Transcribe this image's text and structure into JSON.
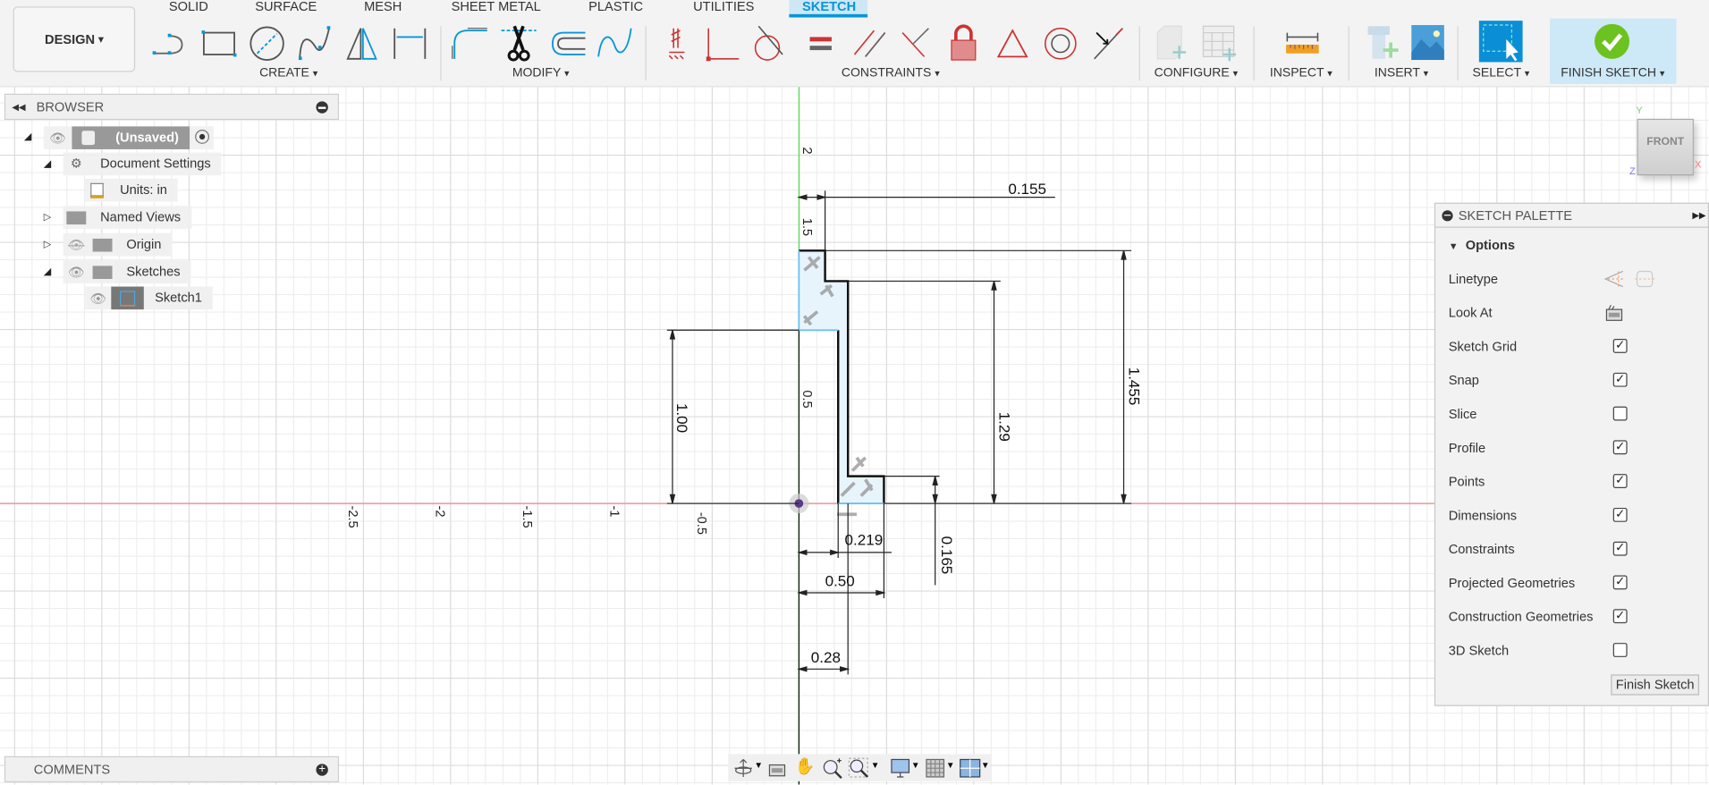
{
  "toolbar": {
    "workspace": "DESIGN",
    "tabs": [
      {
        "label": "SOLID"
      },
      {
        "label": "SURFACE"
      },
      {
        "label": "MESH"
      },
      {
        "label": "SHEET METAL"
      },
      {
        "label": "PLASTIC"
      },
      {
        "label": "UTILITIES"
      },
      {
        "label": "SKETCH",
        "active": true
      }
    ],
    "groups": {
      "create": "CREATE",
      "modify": "MODIFY",
      "constraints": "CONSTRAINTS",
      "configure": "CONFIGURE",
      "inspect": "INSPECT",
      "insert": "INSERT",
      "select": "SELECT",
      "finish": "FINISH SKETCH"
    },
    "dropdown_glyph": "▾",
    "accent": "#0696d7"
  },
  "browser": {
    "title": "BROWSER",
    "items": [
      {
        "label": "(Unsaved)",
        "icon": "component-icon"
      },
      {
        "label": "Document Settings",
        "icon": "gear-icon"
      },
      {
        "label": "Units: in",
        "icon": "units-icon"
      },
      {
        "label": "Named Views",
        "icon": "folder-icon"
      },
      {
        "label": "Origin",
        "icon": "folder-icon",
        "hidden": true
      },
      {
        "label": "Sketches",
        "icon": "folder-icon"
      },
      {
        "label": "Sketch1",
        "icon": "sketch-icon"
      }
    ]
  },
  "comments": {
    "title": "COMMENTS"
  },
  "viewcube": {
    "face": "FRONT",
    "x": "X",
    "y": "Y",
    "z": "Z"
  },
  "palette": {
    "title": "SKETCH PALETTE",
    "section": "Options",
    "linetype": "Linetype",
    "look_at": "Look At",
    "options": [
      {
        "label": "Sketch Grid",
        "checked": true
      },
      {
        "label": "Snap",
        "checked": true
      },
      {
        "label": "Slice",
        "checked": false
      },
      {
        "label": "Profile",
        "checked": true
      },
      {
        "label": "Points",
        "checked": true
      },
      {
        "label": "Dimensions",
        "checked": true
      },
      {
        "label": "Constraints",
        "checked": true
      },
      {
        "label": "Projected Geometries",
        "checked": true
      },
      {
        "label": "Construction Geometries",
        "checked": true
      },
      {
        "label": "3D Sketch",
        "checked": false
      }
    ],
    "finish_button": "Finish Sketch",
    "check_glyph": "✓"
  },
  "sketch": {
    "axis_labels_x": [
      "-0.5",
      "-1",
      "-1.5",
      "-2",
      "-2.5"
    ],
    "axis_labels_y": [
      "0.5",
      "1.5",
      "2"
    ],
    "dimensions": {
      "d0155": "0.155",
      "d1455": "1.455",
      "d129": "1.29",
      "d100": "1.00",
      "d0165": "0.165",
      "d0219": "0.219",
      "d050": "0.50",
      "d028": "0.28"
    },
    "colors": {
      "x_axis": "#f08080",
      "y_axis": "#5fd35f",
      "profile_fill": "#e8f4fc",
      "profile_edge": "#6cc0f0"
    }
  }
}
